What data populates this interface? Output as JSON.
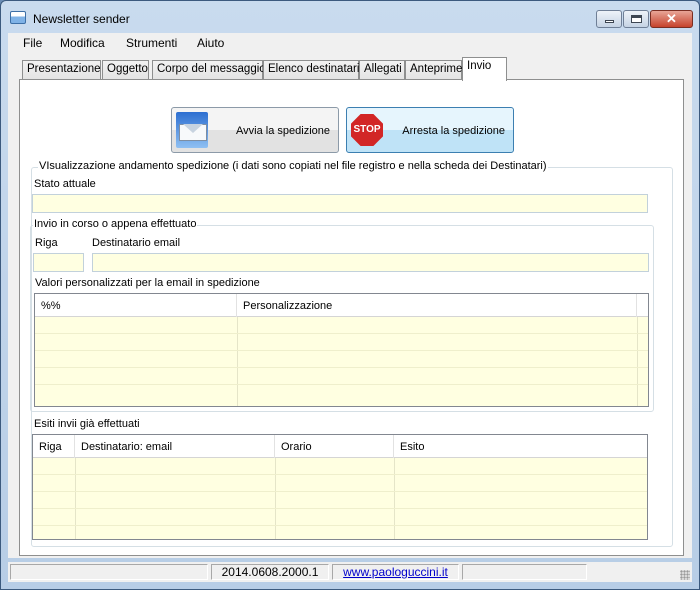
{
  "window": {
    "title": "Newsletter sender"
  },
  "menu": {
    "items": [
      "File",
      "Modifica",
      "Strumenti",
      "Aiuto"
    ]
  },
  "tabs": {
    "items": [
      "Presentazione",
      "Oggetto",
      "Corpo del messaggio",
      "Elenco destinatari",
      "Allegati",
      "Anteprime",
      "Invio"
    ],
    "active": "Invio"
  },
  "actions": {
    "start_label": "Avvia la spedizione",
    "stop_label": "Arresta la spedizione",
    "stop_icon_text": "STOP"
  },
  "progress": {
    "group_title": "VIsualizzazione andamento spedizione (i dati sono copiati nel file registro e nella scheda dei Destinatari)",
    "stato_label": "Stato attuale",
    "stato_value": "",
    "current": {
      "group_title": "Invio in corso o appena effettuato",
      "riga_label": "Riga",
      "riga_value": "",
      "email_label": "Destinatario email",
      "email_value": "",
      "custom_label": "Valori personalizzati per la email in spedizione",
      "custom_columns": [
        "%%",
        "Personalizzazione"
      ],
      "custom_rows": []
    },
    "history": {
      "label": "Esiti invii già effettuati",
      "columns": [
        "Riga",
        "Destinatario: email",
        "Orario",
        "Esito"
      ],
      "rows": []
    }
  },
  "statusbar": {
    "cell1": "",
    "version": "2014.0608.2000.1",
    "link": "www.paologuccini.it",
    "cell4": ""
  },
  "colors": {
    "field_background": "#ffffe1",
    "panel_background": "#ffffff",
    "window_frame": "#b7cde6",
    "stop_red": "#d22626"
  }
}
